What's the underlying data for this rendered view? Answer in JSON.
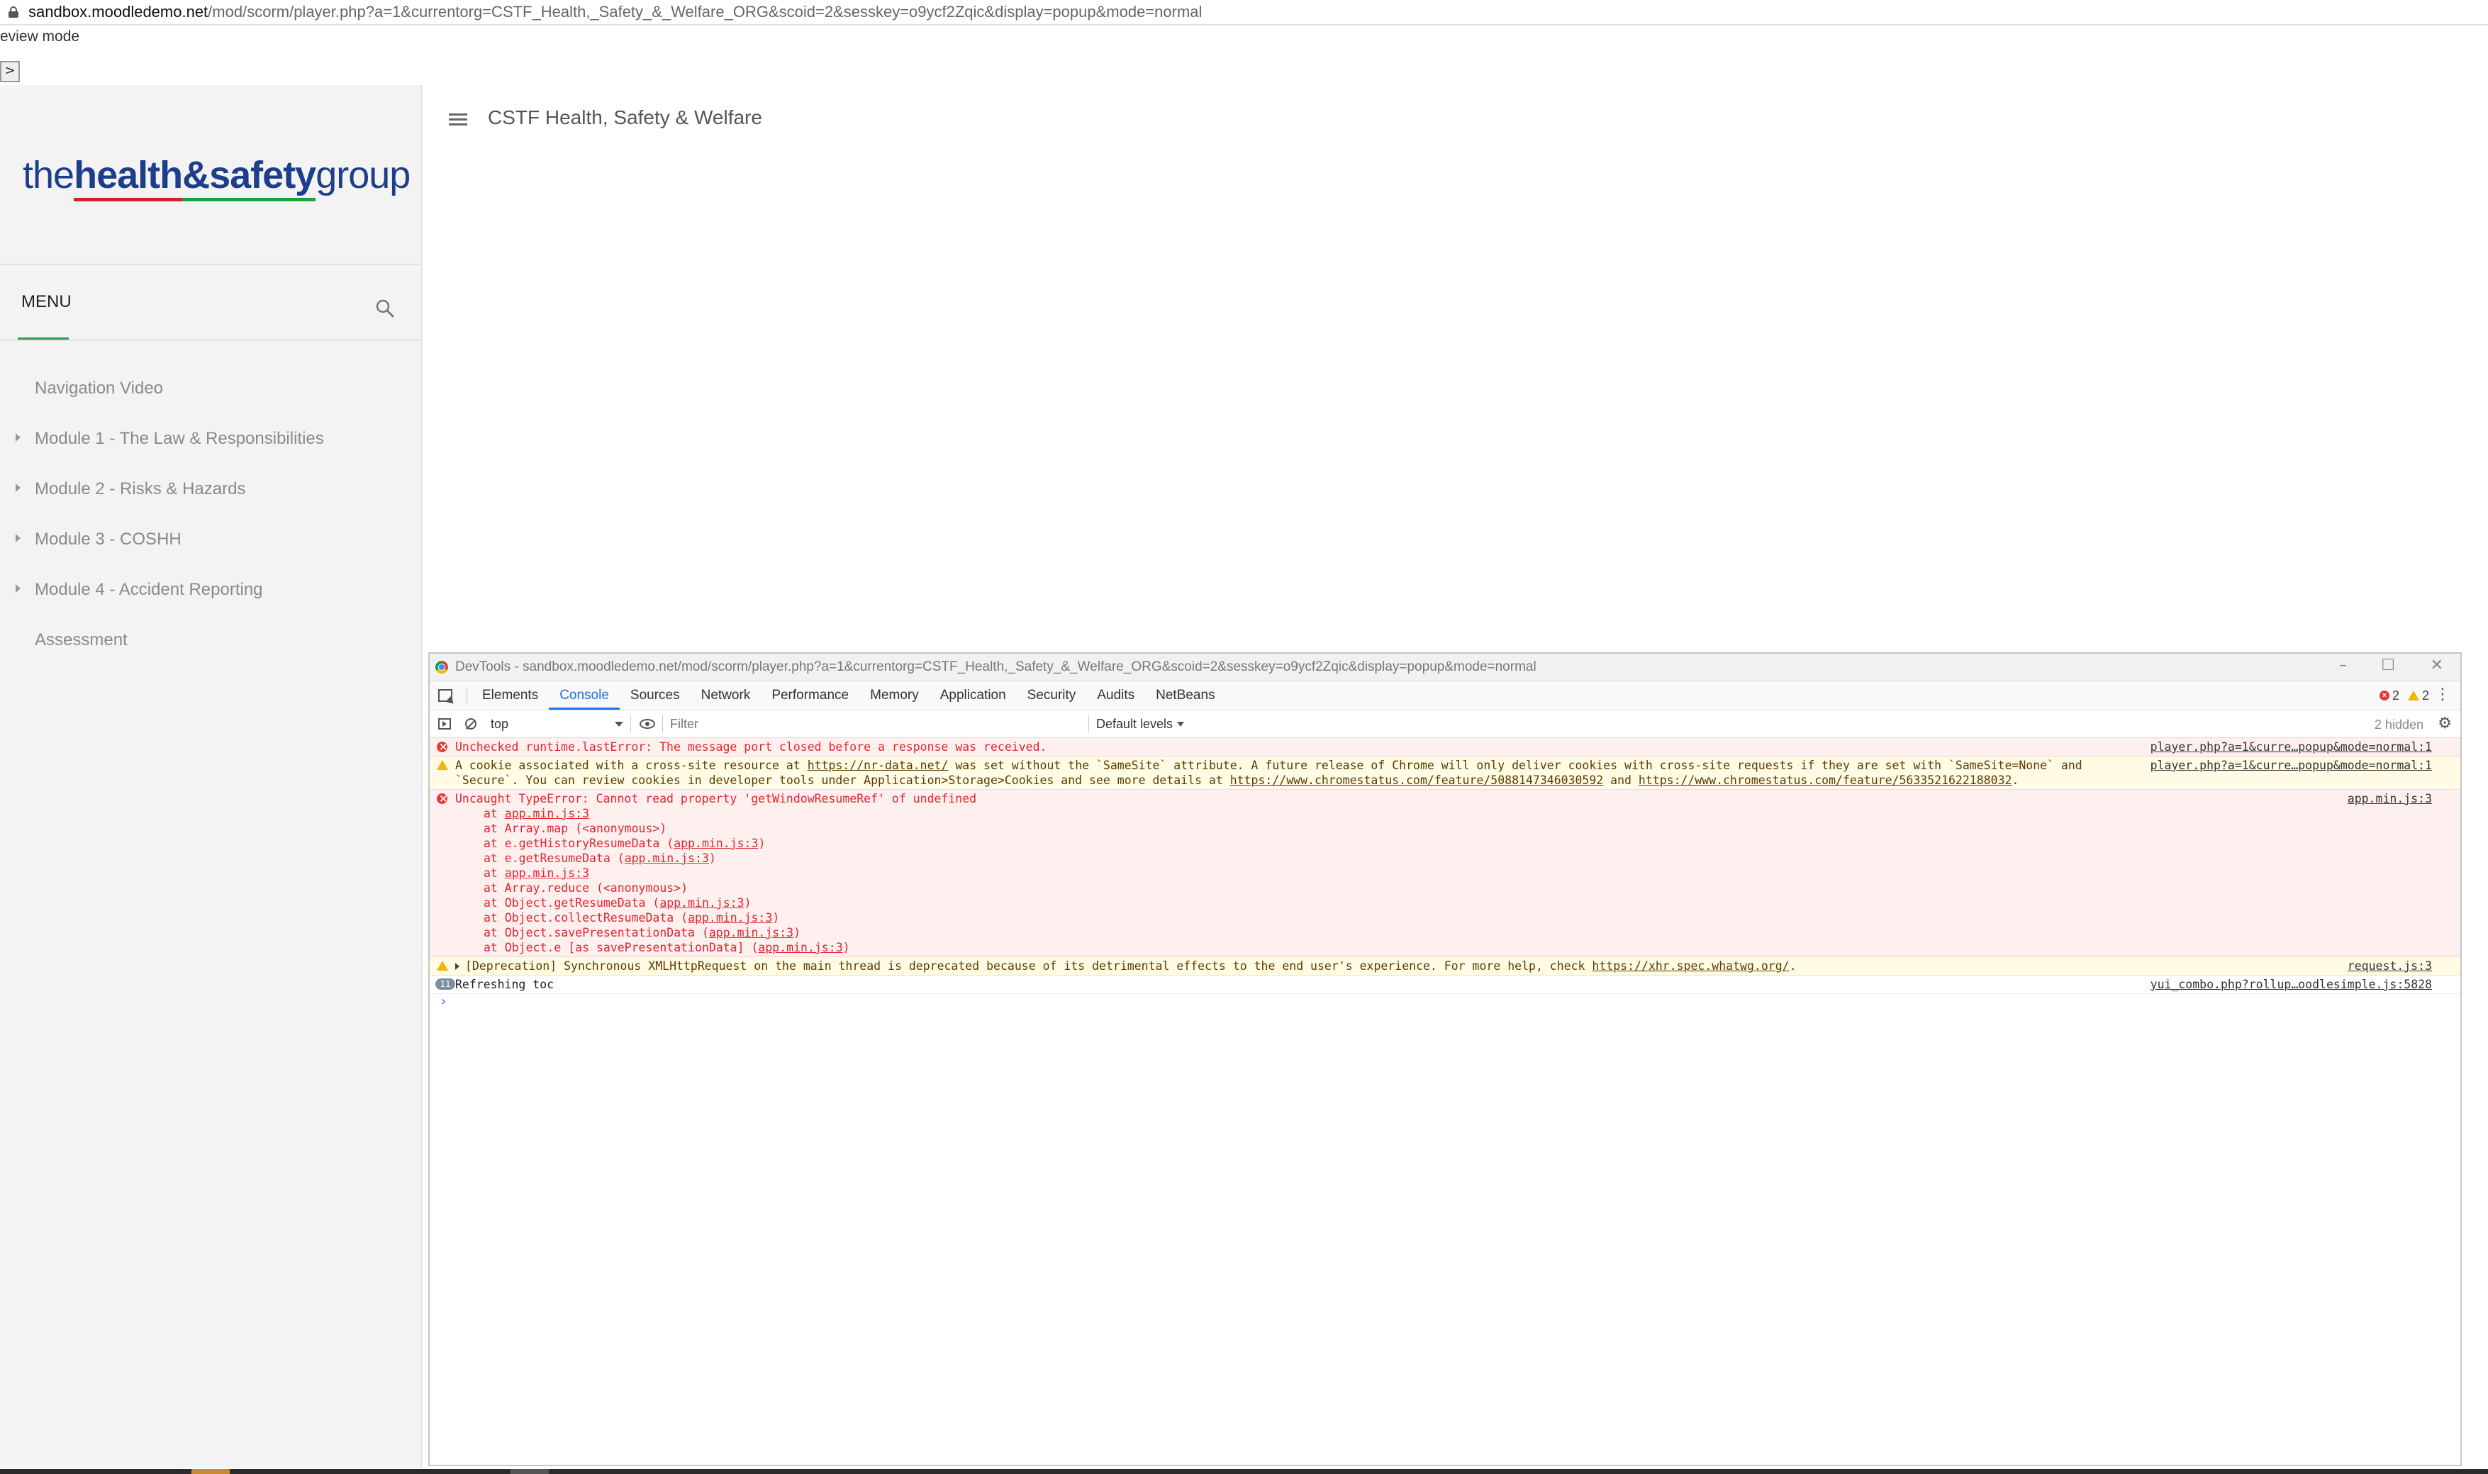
{
  "browser": {
    "url_host": "sandbox.moodledemo.net",
    "url_path": "/mod/scorm/player.php?a=1&currentorg=CSTF_Health,_Safety_&_Welfare_ORG&scoid=2&sesskey=o9ycf2Zqic&display=popup&mode=normal"
  },
  "page": {
    "review_mode": "eview mode",
    "expand_button": ">",
    "title": "CSTF Health, Safety & Welfare"
  },
  "sidebar": {
    "logo": {
      "part1": "the",
      "part2": "health",
      "part3": "&",
      "part4": "safety",
      "part5": "group"
    },
    "menu_label": "MENU",
    "items": [
      {
        "label": "Navigation Video",
        "expandable": false
      },
      {
        "label": "Module 1 - The Law & Responsibilities",
        "expandable": true
      },
      {
        "label": "Module 2 - Risks & Hazards",
        "expandable": true
      },
      {
        "label": "Module 3 - COSHH",
        "expandable": true
      },
      {
        "label": "Module 4 - Accident Reporting",
        "expandable": true
      },
      {
        "label": "Assessment",
        "expandable": false
      }
    ]
  },
  "devtools": {
    "title": "DevTools - sandbox.moodledemo.net/mod/scorm/player.php?a=1&currentorg=CSTF_Health,_Safety_&_Welfare_ORG&scoid=2&sesskey=o9ycf2Zqic&display=popup&mode=normal",
    "window_controls": {
      "minimize": "–",
      "maximize": "☐",
      "close": "✕"
    },
    "tabs": [
      "Elements",
      "Console",
      "Sources",
      "Network",
      "Performance",
      "Memory",
      "Application",
      "Security",
      "Audits",
      "NetBeans"
    ],
    "active_tab": "Console",
    "error_count": "2",
    "warning_count": "2",
    "more_icon": "⋮",
    "toolbar": {
      "context": "top",
      "filter_placeholder": "Filter",
      "levels": "Default levels",
      "hidden": "2 hidden",
      "settings_icon": "⚙"
    },
    "console": {
      "msg1": {
        "text": "Unchecked runtime.lastError: The message port closed before a response was received.",
        "source": "player.php?a=1&curre…popup&mode=normal:1"
      },
      "msg2": {
        "text_a": "A cookie associated with a cross-site resource at ",
        "link_a": "https://nr-data.net/",
        "text_b": " was set without the `SameSite` attribute. A future release of Chrome will only deliver cookies with cross-site requests if they are set with `SameSite=None` and",
        "text_c": "`Secure`. You can review cookies in developer tools under Application>Storage>Cookies and see more details at ",
        "link_b": "https://www.chromestatus.com/feature/5088147346030592",
        "text_d": " and ",
        "link_c": "https://www.chromestatus.com/feature/5633521622188032",
        "text_e": ".",
        "source": "player.php?a=1&curre…popup&mode=normal:1"
      },
      "msg3": {
        "text": "Uncaught TypeError: Cannot read property 'getWindowResumeRef' of undefined",
        "source": "app.min.js:3",
        "stack": [
          {
            "pre": "at ",
            "name": "",
            "link": "app.min.js:3"
          },
          {
            "pre": "at Array.map (<anonymous>)",
            "name": "",
            "link": ""
          },
          {
            "pre": "at e.getHistoryResumeData (",
            "name": "",
            "link": "app.min.js:3"
          },
          {
            "pre": "at e.getResumeData (",
            "name": "",
            "link": "app.min.js:3"
          },
          {
            "pre": "at ",
            "name": "",
            "link": "app.min.js:3"
          },
          {
            "pre": "at Array.reduce (<anonymous>)",
            "name": "",
            "link": ""
          },
          {
            "pre": "at Object.getResumeData (",
            "name": "",
            "link": "app.min.js:3"
          },
          {
            "pre": "at Object.collectResumeData (",
            "name": "",
            "link": "app.min.js:3"
          },
          {
            "pre": "at Object.savePresentationData (",
            "name": "",
            "link": "app.min.js:3"
          },
          {
            "pre": "at Object.e [as savePresentationData] (",
            "name": "",
            "link": "app.min.js:3"
          }
        ]
      },
      "msg4": {
        "text": "[Deprecation] Synchronous XMLHttpRequest on the main thread is deprecated because of its detrimental effects to the end user's experience. For more help, check ",
        "link": "https://xhr.spec.whatwg.org/",
        "text_end": ".",
        "source": "request.js:3"
      },
      "msg5": {
        "badge": "11",
        "text": "Refreshing toc",
        "source": "yui_combo.php?rollup…oodlesimple.js:5828"
      },
      "prompt": "›"
    }
  }
}
